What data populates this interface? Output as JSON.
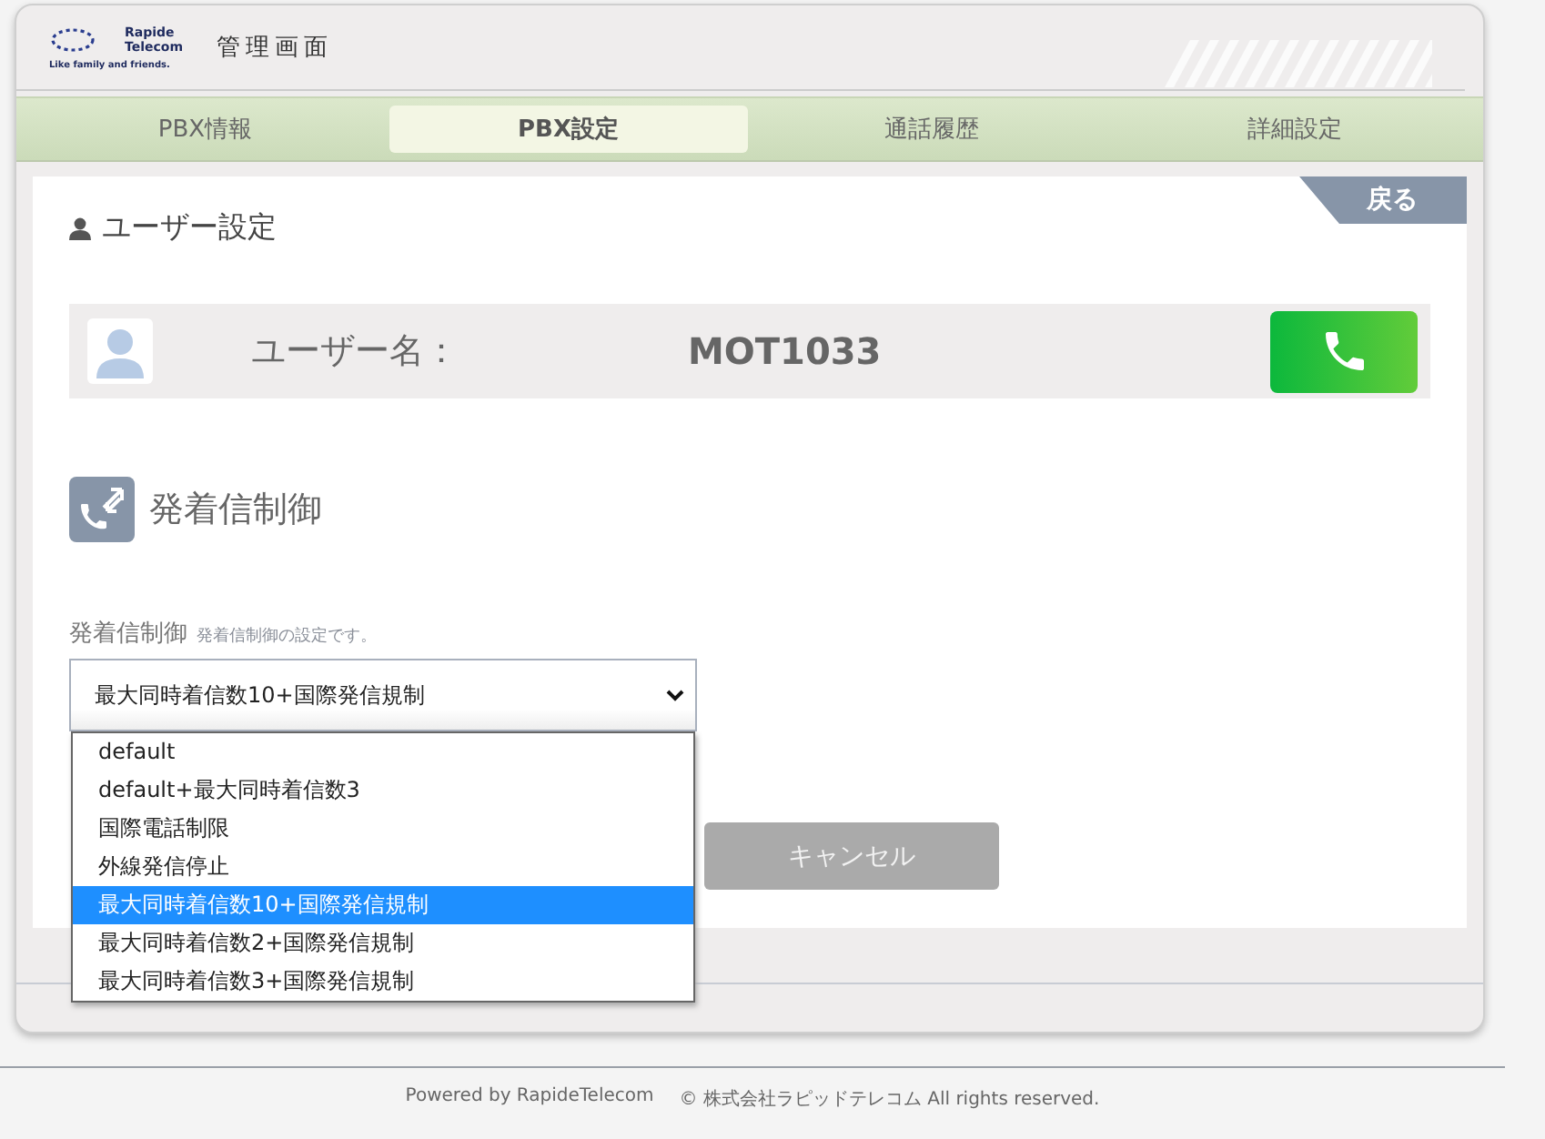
{
  "header": {
    "logo": {
      "name_line1": "Rapide",
      "name_line2": "Telecom",
      "tagline": "Like family and friends."
    },
    "title": "管理画面"
  },
  "tabs": [
    {
      "label": "PBX情報",
      "selected": false
    },
    {
      "label": "PBX設定",
      "selected": true
    },
    {
      "label": "通話履歴",
      "selected": false
    },
    {
      "label": "詳細設定",
      "selected": false
    }
  ],
  "back_button": "戻る",
  "page_title": "ユーザー設定",
  "user": {
    "label": "ユーザー名：",
    "value": "MOT1033"
  },
  "section_title": "発着信制御",
  "field": {
    "label": "発着信制御",
    "hint": "発着信制御の設定です。",
    "value": "最大同時着信数10+国際発信規制",
    "expanded": true,
    "options": [
      {
        "label": "default",
        "selected": false
      },
      {
        "label": "default+最大同時着信数3",
        "selected": false
      },
      {
        "label": "国際電話制限",
        "selected": false
      },
      {
        "label": "外線発信停止",
        "selected": false
      },
      {
        "label": "最大同時着信数10+国際発信規制",
        "selected": true
      },
      {
        "label": "最大同時着信数2+国際発信規制",
        "selected": false
      },
      {
        "label": "最大同時着信数3+国際発信規制",
        "selected": false
      }
    ]
  },
  "buttons": [
    {
      "label": "キャンセル",
      "kind": "cancel"
    }
  ],
  "footer": {
    "powered": "Powered by RapideTelecom",
    "copyright": "© 株式会社ラピッドテレコム All rights reserved."
  }
}
